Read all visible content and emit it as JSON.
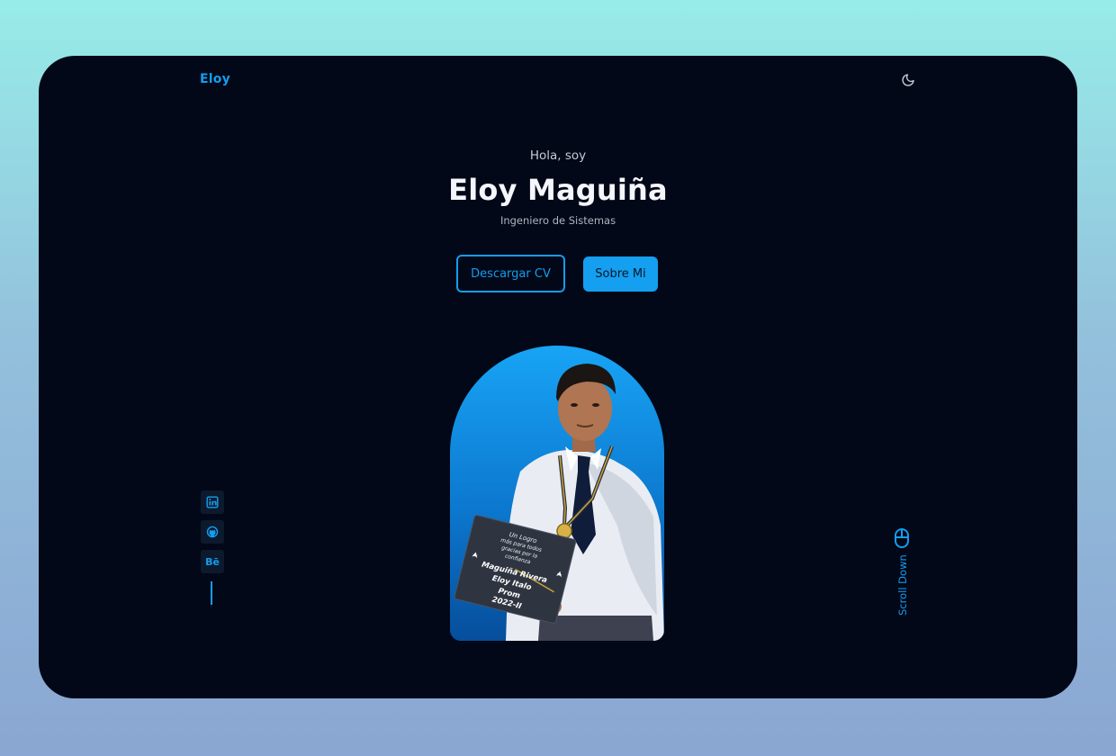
{
  "header": {
    "brand": "Eloy",
    "theme_icon": "moon-icon"
  },
  "hero": {
    "greeting": "Hola, soy",
    "name": "Eloy Maguiña",
    "role": "Ingeniero de Sistemas"
  },
  "actions": {
    "download_cv": "Descargar CV",
    "about_me": "Sobre Mi"
  },
  "photo": {
    "cap_text": [
      "Un Logro",
      "más para todos",
      "gracias por la",
      "confianza",
      "Maguiña Rivera",
      "Eloy Italo",
      "Prom",
      "2022-II"
    ]
  },
  "social": {
    "items": [
      {
        "name": "linkedin",
        "icon": "linkedin-icon"
      },
      {
        "name": "github",
        "icon": "github-icon"
      },
      {
        "name": "behance",
        "icon": "behance-icon",
        "label": "Bē"
      }
    ]
  },
  "scroll": {
    "label": "Scroll Down",
    "icon": "mouse-icon"
  },
  "colors": {
    "accent": "#149ff0",
    "background": "#020817",
    "page_bg_top": "#97ece8",
    "page_bg_bottom": "#8aa6d2"
  }
}
